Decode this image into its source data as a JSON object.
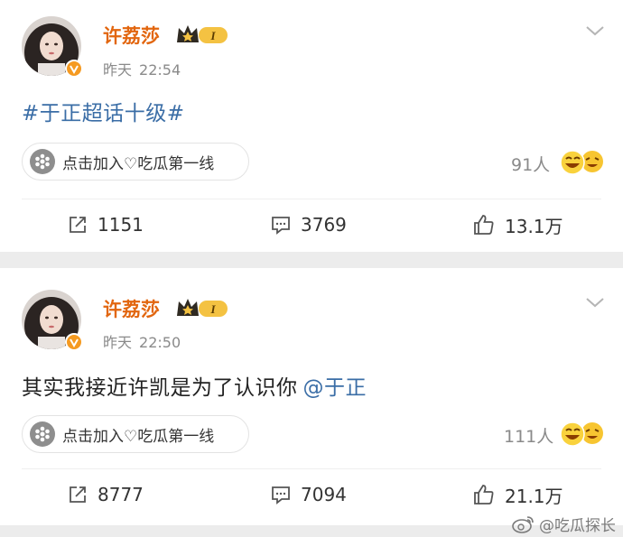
{
  "posts": [
    {
      "username": "许荔莎",
      "level_badge": "I",
      "date": "昨天",
      "time": "22:54",
      "content": "#于正超话十级#",
      "mention": "",
      "group_label": "点击加入♡吃瓜第一线",
      "join_count": "91人",
      "reposts": "1151",
      "comments": "3769",
      "likes": "13.1万"
    },
    {
      "username": "许荔莎",
      "level_badge": "I",
      "date": "昨天",
      "time": "22:50",
      "content": "其实我接近许凯是为了认识你",
      "mention": "@于正",
      "group_label": "点击加入♡吃瓜第一线",
      "join_count": "111人",
      "reposts": "8777",
      "comments": "7094",
      "likes": "21.1万"
    }
  ],
  "watermark": "@吃瓜探长",
  "colors": {
    "username": "#e2660f",
    "topic_link": "#3a6da6",
    "verified_badge": "#f59a21",
    "muted_text": "#8a8a8a"
  },
  "icons": [
    "avatar",
    "verified-icon",
    "crown-level-icon",
    "chevron-down-icon",
    "group-icon",
    "laugh-emoji-icon",
    "repost-icon",
    "comment-icon",
    "like-icon",
    "weibo-logo-icon"
  ]
}
